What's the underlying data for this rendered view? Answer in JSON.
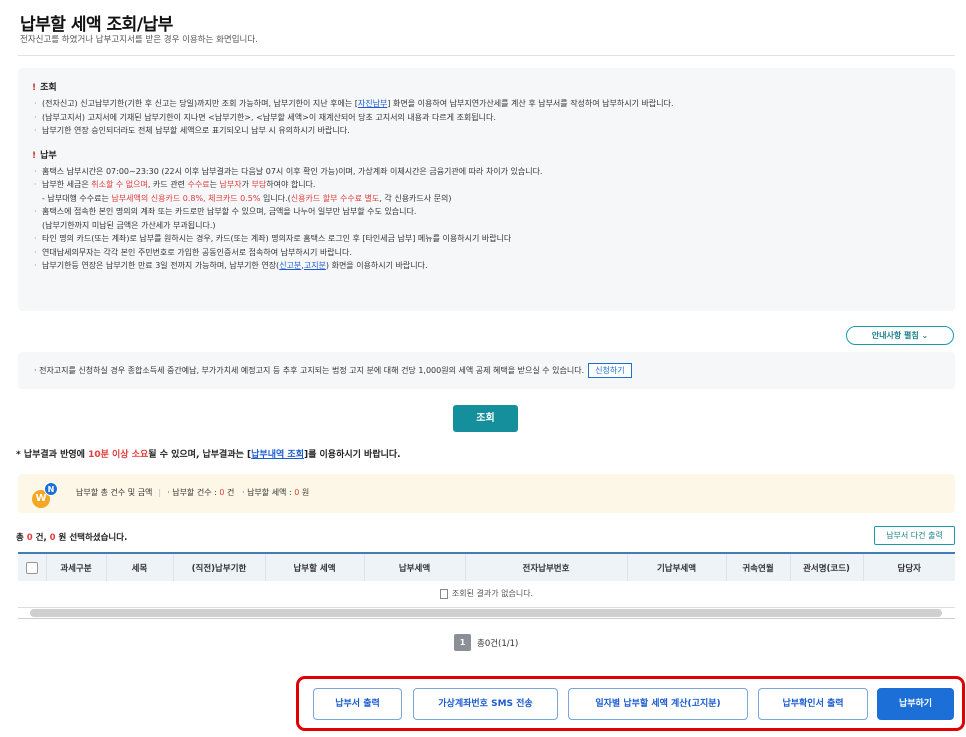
{
  "header": {
    "title": "납부할 세액 조회/납부",
    "subtitle": "전자신고를 하였거나 납부고지서를 받은 경우 이용하는 화면입니다."
  },
  "notice": {
    "lookup_title": "조회",
    "lookup_items": [
      [
        "(전자신고) 신고납부기한(기한 후 신고는 당일)까지만 조회 가능하며, 납부기한이 지난 후에는 [",
        "자진납부",
        "] 화면을 이용하여 납부지연가산세를 계산 후 납부서를 작성하여 납부하시기 바랍니다."
      ],
      "(납부고지서) 고지서에 기재된 납부기한이 지나면 <납부기한>, <납부할 세액>이 재계산되어 당초 고지서의 내용과 다르게 조회됩니다.",
      "납부기한 연장 승인되더라도 전체 납부할 세액으로 표기되오니 납부 시 유의하시기 바랍니다."
    ],
    "pay_title": "납부",
    "pay_items": {
      "hours": "홈택스 납부시간은 07:00~23:30 (22시 이후 납부결과는 다음날 07시 이후 확인 가능)이며, 가상계좌 이체시간은 금융기관에 따라 차이가 있습니다.",
      "cancel": [
        "납부한 세금은 ",
        "취소할 수 없으며",
        ", 카드 관련 ",
        "수수료",
        "는 ",
        "납부자",
        "가 ",
        "부담",
        "하여야 합니다."
      ],
      "fee": [
        "- 납부대행 수수료는 ",
        "납부세액의 신용카드 0.8%, 체크카드 0.5%",
        " 입니다.(",
        "신용카드 할부 수수료 별도",
        ", 각 신용카드사 문의)"
      ],
      "partial_1": "홈택스에 접속한 본인 명의의 계좌 또는 카드로만 납부할 수 있으며, 금액을 나누어 일부만 납부할 수도 있습니다.",
      "partial_2": "(납부기한까지 미납된 금액은 가산세가 부과됩니다.)",
      "other": "타인 명의 카드(또는 계좌)로 납부를 원하시는 경우, 카드(또는 계좌) 명의자로 홈택스 로그인 후 [타인세금 납부] 메뉴를 이용하시기 바랍니다",
      "joint": "연대납세의무자는 각각 본인 주민번호로 가입한 공동인증서로 접속하여 납부하시기 바랍니다.",
      "extend": [
        "납부기한등 연장은 납부기한 만료 3일 전까지 가능하며, 납부기한 연장(",
        "신고분",
        ",",
        "고지분",
        ") 화면을 이용하시기 바랍니다."
      ]
    }
  },
  "guide_button": "안내사항 펼침 ⌄",
  "einfo": {
    "text": "· 전자고지를 신청하실 경우 종합소득세 중간예납, 부가가치세 예정고지 등 추후 고지되는 법정 고지 분에 대해 건당 1,000원의 세액 공제 혜택을 받으실 수 있습니다.",
    "apply_label": "신청하기"
  },
  "search_label": "조회",
  "pay_result": [
    "* 납부결과 반영에 ",
    "10분 이상 소요",
    "될 수 있으며, 납부결과는 [",
    "납부내역 조회",
    "]를 이용하시기 바랍니다."
  ],
  "summary": {
    "logo_w1": "W",
    "logo_w2": "N",
    "label": "납부할 총 건수 및 금액",
    "count_label": "· 납부할 건수 : ",
    "count_value": "0",
    "count_unit": " 건",
    "amount_label": "· 납부할 세액 : ",
    "amount_value": "0",
    "amount_unit": " 원"
  },
  "total": {
    "prefix": "총 ",
    "count": "0",
    "mid": " 건, ",
    "amount": "0",
    "suffix": " 원 선택하셨습니다."
  },
  "multi_print_label": "납부서 다건 출력",
  "table": {
    "headers": [
      "과세구분",
      "세목",
      "(직전)납부기한",
      "납부할 세액",
      "납부세액",
      "전자납부번호",
      "기납부세액",
      "귀속연월",
      "관서명(코드)",
      "담당자"
    ],
    "empty_message": "조회된 결과가 없습니다."
  },
  "pager": {
    "page": "1",
    "total": "총0건(1/1)"
  },
  "actions": {
    "print": "납부서 출력",
    "sms": "가상계좌번호 SMS 전송",
    "daily": "일자별 납부할 세액 계산(고지분)",
    "confirm_print": "납부확인서 출력",
    "pay": "납부하기"
  },
  "colors": {
    "accent": "#168f9c",
    "primary": "#1b6fd6",
    "highlight_red": "#e23b3b",
    "focus_border": "#e00000"
  }
}
